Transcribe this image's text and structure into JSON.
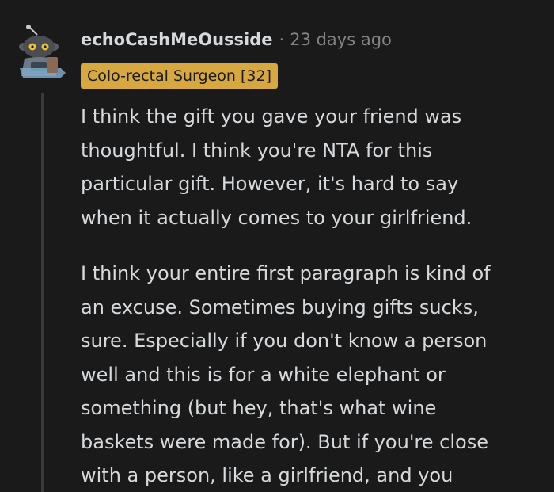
{
  "comment": {
    "username": "echoCashMeOusside",
    "separator": "·",
    "timestamp": "23 days ago",
    "flair": "Colo-rectal Surgeon [32]",
    "flair_color": "#d6a83f",
    "avatar_icon": "snoo-robot-avatar-icon",
    "paragraphs": [
      {
        "lines": [
          "I think the gift you gave your friend was",
          "thoughtful. I think you're NTA for this",
          "particular gift. However, it's hard to say",
          "when it actually comes to your girlfriend."
        ]
      },
      {
        "lines": [
          "I think your entire first paragraph is kind of",
          "an excuse. Sometimes buying gifts sucks,",
          "sure. Especially if you don't know a person",
          "well and this is for a white elephant or",
          "something (but hey, that's what wine",
          "baskets were made for). But if you're close",
          "with a person, like a girlfriend, and you"
        ]
      }
    ]
  }
}
